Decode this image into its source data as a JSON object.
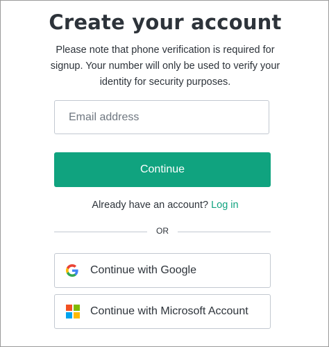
{
  "page": {
    "title": "Create your account",
    "subtitle": "Please note that phone verification is required for signup. Your number will only be used to verify your identity for security purposes."
  },
  "email": {
    "placeholder": "Email address",
    "value": ""
  },
  "continue_button": {
    "label": "Continue"
  },
  "login_prompt": {
    "text": "Already have an account?",
    "link_label": "Log in"
  },
  "divider": {
    "label": "OR"
  },
  "social": {
    "google": {
      "label": "Continue with Google",
      "icon": "google-logo-icon"
    },
    "microsoft": {
      "label": "Continue with Microsoft Account",
      "icon": "microsoft-logo-icon"
    }
  },
  "colors": {
    "accent": "#10a37f",
    "text": "#2d333a",
    "border": "#c2c8d0",
    "google_blue": "#4285F4",
    "google_red": "#EA4335",
    "google_yellow": "#FBBC05",
    "google_green": "#34A853",
    "ms_red": "#F25022",
    "ms_green": "#7FBA00",
    "ms_blue": "#00A4EF",
    "ms_yellow": "#FFB900"
  }
}
